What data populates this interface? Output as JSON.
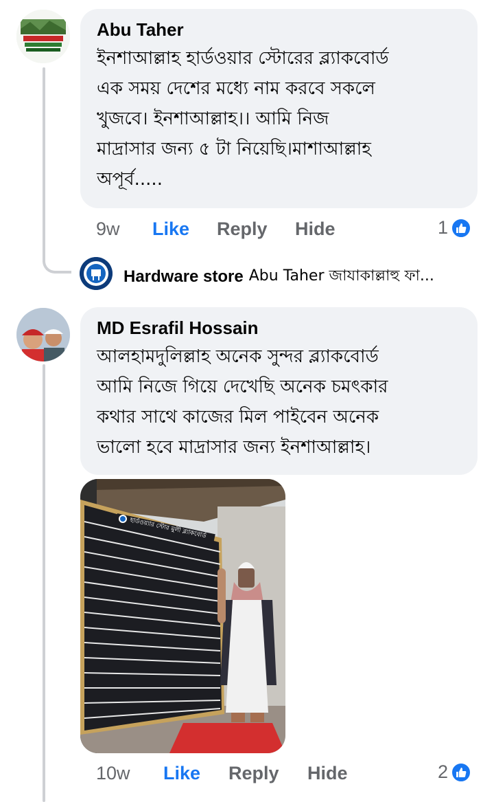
{
  "comments": [
    {
      "author": "Abu Taher",
      "text": "ইনশাআল্লাহ হার্ডওয়ার স্টোরের ব্ল্যাকবোর্ড\nএক সময় দেশের মধ্যে নাম করবে সকলে\nখুজবে। ইনশাআল্লাহ।। আমি নিজ\nমাদ্রাসার জন্য ৫ টা নিয়েছি।মাশাআল্লাহ\nঅপূর্ব.....",
      "time": "9w",
      "like_label": "Like",
      "reply_label": "Reply",
      "hide_label": "Hide",
      "reaction_count": "1"
    },
    {
      "author": "MD Esrafil Hossain",
      "text": "আলহামদুলিল্লাহ অনেক সুন্দর ব্ল্যাকবোর্ড\nআমি নিজে গিয়ে দেখেছি অনেক চমৎকার\nকথার সাথে কাজের মিল পাইবেন অনেক\nভালো হবে মাদ্রাসার জন্য ইনশাআল্লাহ।",
      "time": "10w",
      "like_label": "Like",
      "reply_label": "Reply",
      "hide_label": "Hide",
      "reaction_count": "2"
    }
  ],
  "reply_preview": {
    "author": "Hardware store",
    "text": "Abu Taher জাযাকাল্লাহু ফা..."
  },
  "photo": {
    "board_header": "হার্ডওয়্যার স্টোর মুলী ব্ল্যাকবোর্ড"
  },
  "colors": {
    "bubble": "#f0f2f5",
    "like_blue": "#1877f2",
    "meta_gray": "#65676b"
  },
  "icons": {
    "reaction": "like-thumb-icon"
  }
}
